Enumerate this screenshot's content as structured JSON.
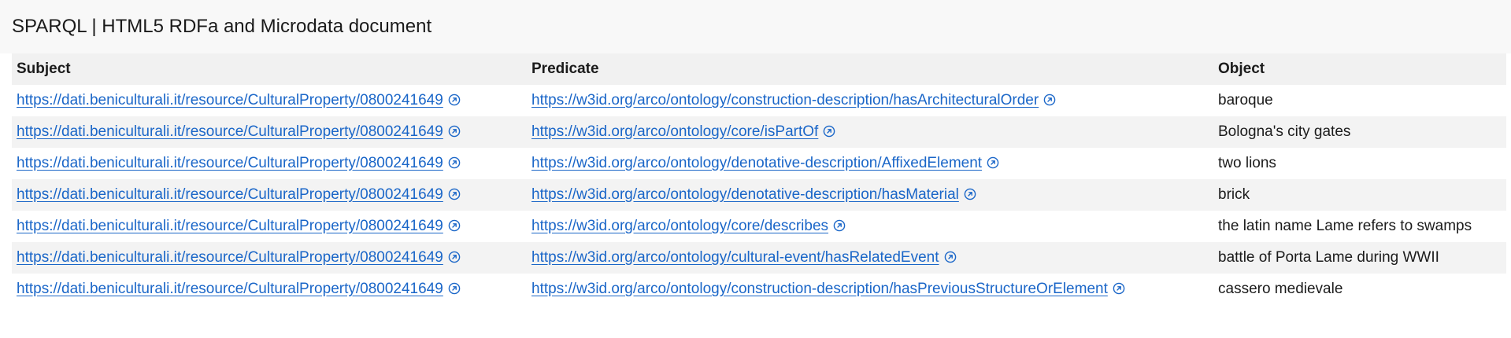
{
  "page": {
    "title": "SPARQL | HTML5 RDFa and Microdata document"
  },
  "table": {
    "headers": [
      "Subject",
      "Predicate",
      "Object"
    ],
    "rows": [
      {
        "subject": "https://dati.beniculturali.it/resource/CulturalProperty/0800241649",
        "predicate": "https://w3id.org/arco/ontology/construction-description/hasArchitecturalOrder",
        "object": "baroque"
      },
      {
        "subject": "https://dati.beniculturali.it/resource/CulturalProperty/0800241649",
        "predicate": "https://w3id.org/arco/ontology/core/isPartOf",
        "object": "Bologna's city gates"
      },
      {
        "subject": "https://dati.beniculturali.it/resource/CulturalProperty/0800241649",
        "predicate": "https://w3id.org/arco/ontology/denotative-description/AffixedElement",
        "object": "two lions"
      },
      {
        "subject": "https://dati.beniculturali.it/resource/CulturalProperty/0800241649",
        "predicate": "https://w3id.org/arco/ontology/denotative-description/hasMaterial",
        "object": "brick"
      },
      {
        "subject": "https://dati.beniculturali.it/resource/CulturalProperty/0800241649",
        "predicate": "https://w3id.org/arco/ontology/core/describes",
        "object": "the latin name Lame refers to swamps"
      },
      {
        "subject": "https://dati.beniculturali.it/resource/CulturalProperty/0800241649",
        "predicate": "https://w3id.org/arco/ontology/cultural-event/hasRelatedEvent",
        "object": "battle of Porta Lame during WWII"
      },
      {
        "subject": "https://dati.beniculturali.it/resource/CulturalProperty/0800241649",
        "predicate": "https://w3id.org/arco/ontology/construction-description/hasPreviousStructureOrElement",
        "object": "cassero medievale"
      }
    ]
  },
  "icons": {
    "link_icon": "external-link-icon"
  },
  "colors": {
    "link": "#1a66c8",
    "header_band": "#f8f8f8",
    "table_header": "#f1f1f1",
    "row_stripe": "#f3f3f3"
  }
}
